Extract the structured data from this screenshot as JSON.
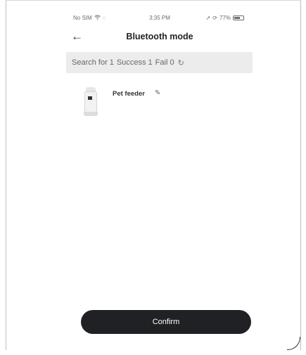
{
  "status_bar": {
    "carrier": "No SIM",
    "time": "3:35 PM",
    "battery": "77%"
  },
  "nav": {
    "back_icon": "arrow-left-icon",
    "title": "Bluetooth mode"
  },
  "summary": {
    "search_label": "Search for 1",
    "success_label": "Success 1",
    "fail_label": "Fail 0",
    "refresh_icon": "refresh-icon"
  },
  "devices": [
    {
      "name": "Pet feeder",
      "edit_icon": "pencil-icon"
    }
  ],
  "confirm_button": {
    "label": "Confirm"
  },
  "colors": {
    "summary_bg": "#ececec",
    "button_bg": "#202124",
    "button_text": "#ffffff"
  }
}
